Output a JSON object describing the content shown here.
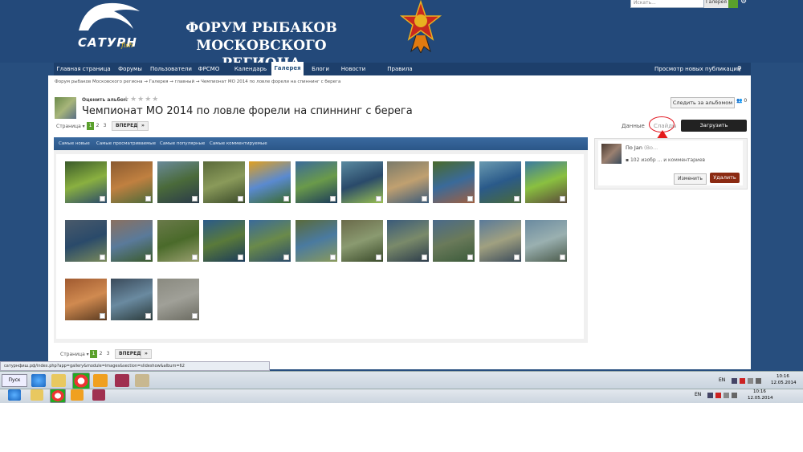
{
  "header": {
    "logo_text": "САТУРН",
    "logo_sub": "fish",
    "title_line1": "ФОРУМ РЫБАКОВ",
    "title_line2": "МОСКОВСКОГО РЕГИОНА",
    "search_placeholder": "Искать...",
    "search_scope": "Галерея"
  },
  "nav": {
    "items": [
      "Главная страница",
      "Форумы",
      "Пользователи",
      "ФРСМО",
      "Календарь",
      "Галерея",
      "Блоги",
      "Новости",
      "Правила форума"
    ],
    "active_index": 5,
    "right_link": "Просмотр новых публикаций"
  },
  "breadcrumb": [
    "Форум рыбаков Московского региона",
    "Галерея",
    "главный",
    "Чемпионат МО 2014 по ловле форели на спиннинг с берега"
  ],
  "album": {
    "rate_label": "Оценить альбом",
    "title": "Чемпионат МО 2014 по ловле форели на спиннинг с берега",
    "follow_label": "Следить за альбомом",
    "follow_count": "0",
    "view_data": "Данные",
    "view_slides": "Слайды",
    "upload_label": "Загрузить изображение"
  },
  "pager": {
    "label": "Страница",
    "pages": [
      "1",
      "2",
      "3"
    ],
    "current": "1",
    "next": "ВПЕРЕД",
    "last": "»"
  },
  "sort_tabs": [
    "Самые новые",
    "Самые просматриваемые",
    "Самые популярные",
    "Самые комментируемые"
  ],
  "infobox": {
    "by": "По Jan",
    "by_extra": "(Во...",
    "comments_count": "102",
    "comments_pre": "изобр",
    "comments_post": "и комментариев",
    "edit_label": "Изменить",
    "delete_label": "Удалить"
  },
  "status_url": "сатурнфиш.рф/index.php?app=gallery&module=images&section=slideshow&album=62",
  "taskbar": {
    "start_label": "Пуск",
    "lang": "EN",
    "time1": "10:16",
    "date1": "12.05.2014",
    "time2": "10:16",
    "date2": "12.05.2014"
  },
  "photos_row_counts": [
    11,
    11,
    3
  ]
}
